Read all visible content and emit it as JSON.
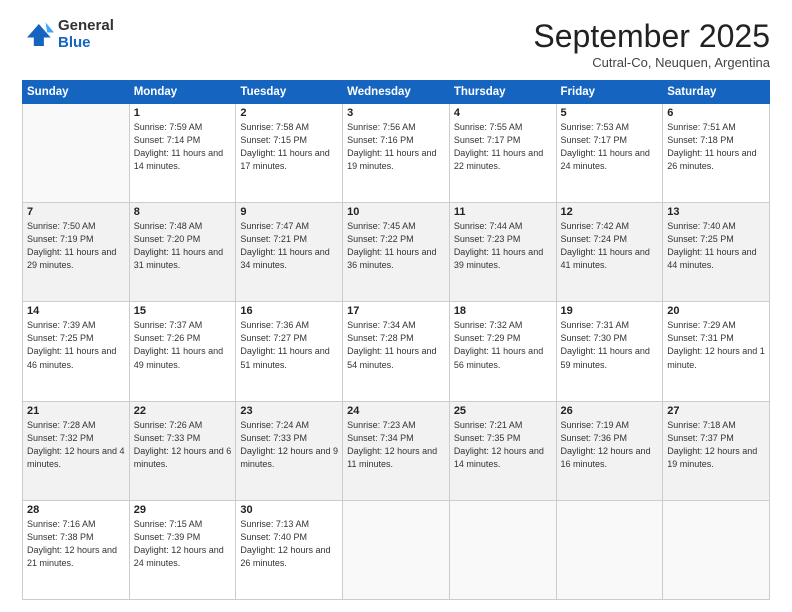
{
  "logo": {
    "general": "General",
    "blue": "Blue"
  },
  "header": {
    "month": "September 2025",
    "location": "Cutral-Co, Neuquen, Argentina"
  },
  "days_of_week": [
    "Sunday",
    "Monday",
    "Tuesday",
    "Wednesday",
    "Thursday",
    "Friday",
    "Saturday"
  ],
  "weeks": [
    [
      {
        "day": "",
        "sunrise": "",
        "sunset": "",
        "daylight": ""
      },
      {
        "day": "1",
        "sunrise": "Sunrise: 7:59 AM",
        "sunset": "Sunset: 7:14 PM",
        "daylight": "Daylight: 11 hours and 14 minutes."
      },
      {
        "day": "2",
        "sunrise": "Sunrise: 7:58 AM",
        "sunset": "Sunset: 7:15 PM",
        "daylight": "Daylight: 11 hours and 17 minutes."
      },
      {
        "day": "3",
        "sunrise": "Sunrise: 7:56 AM",
        "sunset": "Sunset: 7:16 PM",
        "daylight": "Daylight: 11 hours and 19 minutes."
      },
      {
        "day": "4",
        "sunrise": "Sunrise: 7:55 AM",
        "sunset": "Sunset: 7:17 PM",
        "daylight": "Daylight: 11 hours and 22 minutes."
      },
      {
        "day": "5",
        "sunrise": "Sunrise: 7:53 AM",
        "sunset": "Sunset: 7:17 PM",
        "daylight": "Daylight: 11 hours and 24 minutes."
      },
      {
        "day": "6",
        "sunrise": "Sunrise: 7:51 AM",
        "sunset": "Sunset: 7:18 PM",
        "daylight": "Daylight: 11 hours and 26 minutes."
      }
    ],
    [
      {
        "day": "7",
        "sunrise": "Sunrise: 7:50 AM",
        "sunset": "Sunset: 7:19 PM",
        "daylight": "Daylight: 11 hours and 29 minutes."
      },
      {
        "day": "8",
        "sunrise": "Sunrise: 7:48 AM",
        "sunset": "Sunset: 7:20 PM",
        "daylight": "Daylight: 11 hours and 31 minutes."
      },
      {
        "day": "9",
        "sunrise": "Sunrise: 7:47 AM",
        "sunset": "Sunset: 7:21 PM",
        "daylight": "Daylight: 11 hours and 34 minutes."
      },
      {
        "day": "10",
        "sunrise": "Sunrise: 7:45 AM",
        "sunset": "Sunset: 7:22 PM",
        "daylight": "Daylight: 11 hours and 36 minutes."
      },
      {
        "day": "11",
        "sunrise": "Sunrise: 7:44 AM",
        "sunset": "Sunset: 7:23 PM",
        "daylight": "Daylight: 11 hours and 39 minutes."
      },
      {
        "day": "12",
        "sunrise": "Sunrise: 7:42 AM",
        "sunset": "Sunset: 7:24 PM",
        "daylight": "Daylight: 11 hours and 41 minutes."
      },
      {
        "day": "13",
        "sunrise": "Sunrise: 7:40 AM",
        "sunset": "Sunset: 7:25 PM",
        "daylight": "Daylight: 11 hours and 44 minutes."
      }
    ],
    [
      {
        "day": "14",
        "sunrise": "Sunrise: 7:39 AM",
        "sunset": "Sunset: 7:25 PM",
        "daylight": "Daylight: 11 hours and 46 minutes."
      },
      {
        "day": "15",
        "sunrise": "Sunrise: 7:37 AM",
        "sunset": "Sunset: 7:26 PM",
        "daylight": "Daylight: 11 hours and 49 minutes."
      },
      {
        "day": "16",
        "sunrise": "Sunrise: 7:36 AM",
        "sunset": "Sunset: 7:27 PM",
        "daylight": "Daylight: 11 hours and 51 minutes."
      },
      {
        "day": "17",
        "sunrise": "Sunrise: 7:34 AM",
        "sunset": "Sunset: 7:28 PM",
        "daylight": "Daylight: 11 hours and 54 minutes."
      },
      {
        "day": "18",
        "sunrise": "Sunrise: 7:32 AM",
        "sunset": "Sunset: 7:29 PM",
        "daylight": "Daylight: 11 hours and 56 minutes."
      },
      {
        "day": "19",
        "sunrise": "Sunrise: 7:31 AM",
        "sunset": "Sunset: 7:30 PM",
        "daylight": "Daylight: 11 hours and 59 minutes."
      },
      {
        "day": "20",
        "sunrise": "Sunrise: 7:29 AM",
        "sunset": "Sunset: 7:31 PM",
        "daylight": "Daylight: 12 hours and 1 minute."
      }
    ],
    [
      {
        "day": "21",
        "sunrise": "Sunrise: 7:28 AM",
        "sunset": "Sunset: 7:32 PM",
        "daylight": "Daylight: 12 hours and 4 minutes."
      },
      {
        "day": "22",
        "sunrise": "Sunrise: 7:26 AM",
        "sunset": "Sunset: 7:33 PM",
        "daylight": "Daylight: 12 hours and 6 minutes."
      },
      {
        "day": "23",
        "sunrise": "Sunrise: 7:24 AM",
        "sunset": "Sunset: 7:33 PM",
        "daylight": "Daylight: 12 hours and 9 minutes."
      },
      {
        "day": "24",
        "sunrise": "Sunrise: 7:23 AM",
        "sunset": "Sunset: 7:34 PM",
        "daylight": "Daylight: 12 hours and 11 minutes."
      },
      {
        "day": "25",
        "sunrise": "Sunrise: 7:21 AM",
        "sunset": "Sunset: 7:35 PM",
        "daylight": "Daylight: 12 hours and 14 minutes."
      },
      {
        "day": "26",
        "sunrise": "Sunrise: 7:19 AM",
        "sunset": "Sunset: 7:36 PM",
        "daylight": "Daylight: 12 hours and 16 minutes."
      },
      {
        "day": "27",
        "sunrise": "Sunrise: 7:18 AM",
        "sunset": "Sunset: 7:37 PM",
        "daylight": "Daylight: 12 hours and 19 minutes."
      }
    ],
    [
      {
        "day": "28",
        "sunrise": "Sunrise: 7:16 AM",
        "sunset": "Sunset: 7:38 PM",
        "daylight": "Daylight: 12 hours and 21 minutes."
      },
      {
        "day": "29",
        "sunrise": "Sunrise: 7:15 AM",
        "sunset": "Sunset: 7:39 PM",
        "daylight": "Daylight: 12 hours and 24 minutes."
      },
      {
        "day": "30",
        "sunrise": "Sunrise: 7:13 AM",
        "sunset": "Sunset: 7:40 PM",
        "daylight": "Daylight: 12 hours and 26 minutes."
      },
      {
        "day": "",
        "sunrise": "",
        "sunset": "",
        "daylight": ""
      },
      {
        "day": "",
        "sunrise": "",
        "sunset": "",
        "daylight": ""
      },
      {
        "day": "",
        "sunrise": "",
        "sunset": "",
        "daylight": ""
      },
      {
        "day": "",
        "sunrise": "",
        "sunset": "",
        "daylight": ""
      }
    ]
  ]
}
